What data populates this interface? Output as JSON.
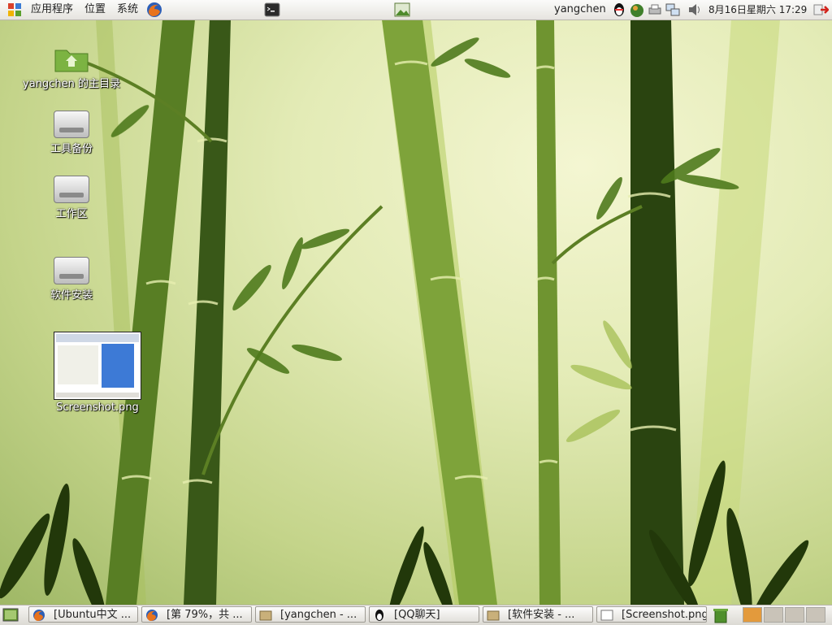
{
  "top_panel": {
    "menus": [
      "应用程序",
      "位置",
      "系统"
    ],
    "launchers": [
      "firefox-icon",
      "terminal-icon",
      "screenshot-icon"
    ],
    "user": "yangchen",
    "clock": "8月16日星期六  17:29",
    "tray": [
      "qq-icon",
      "chicken-icon",
      "printer-icon",
      "network-icon",
      "volume-icon",
      "logout-icon"
    ]
  },
  "desktop": {
    "icons": [
      {
        "label": "yangchen 的主目录",
        "type": "home-folder-icon"
      },
      {
        "label": "工具备份",
        "type": "drive-icon"
      },
      {
        "label": "工作区",
        "type": "drive-icon"
      },
      {
        "label": "软件安装",
        "type": "drive-icon"
      },
      {
        "label": "Screenshot.png",
        "type": "image-thumbnail"
      }
    ]
  },
  "taskbar": {
    "items": [
      {
        "label": "[Ubuntu中文 ...",
        "icon": "firefox-icon"
      },
      {
        "label": "[第  79%，共 ...",
        "icon": "firefox-icon"
      },
      {
        "label": "[yangchen - ...",
        "icon": "folder-icon"
      },
      {
        "label": "[QQ聊天]",
        "icon": "qq-icon"
      },
      {
        "label": "[软件安装  - ...",
        "icon": "folder-icon"
      },
      {
        "label": "[Screenshot.png]",
        "icon": "image-icon"
      }
    ],
    "workspaces": 4,
    "active_workspace": 1
  },
  "colors": {
    "panel": "#e8e6e1",
    "wallpaper_light": "#eef2c8",
    "bamboo_dark": "#2f4a12",
    "bamboo_mid": "#6f8f2a",
    "workspace_active": "#e39a3c"
  }
}
